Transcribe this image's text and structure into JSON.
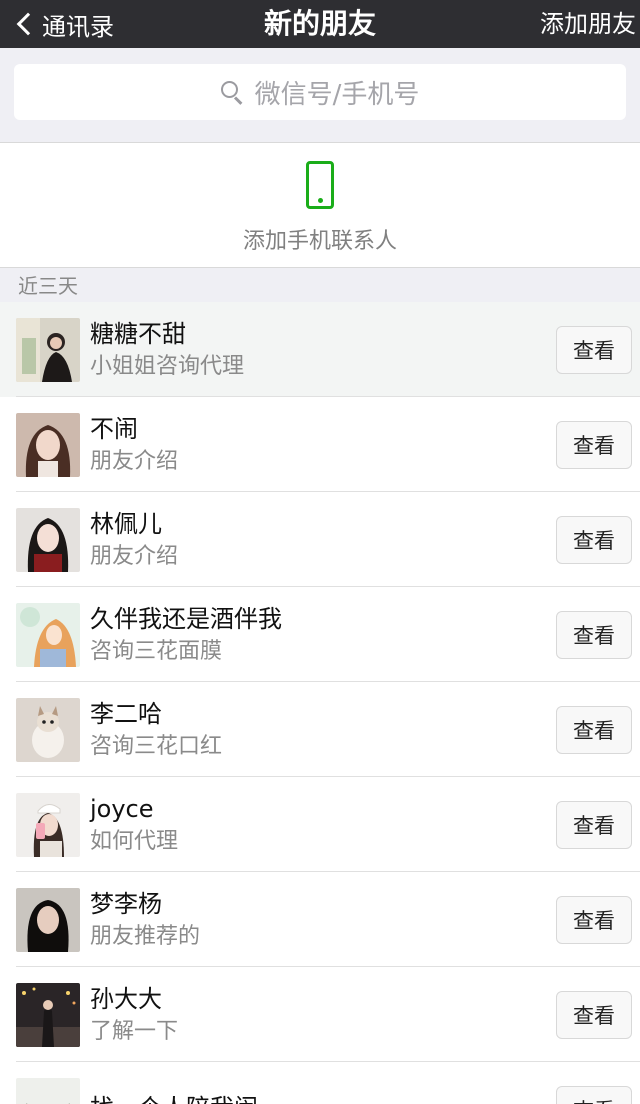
{
  "nav": {
    "back_label": "通讯录",
    "title": "新的朋友",
    "right_label": "添加朋友"
  },
  "search": {
    "placeholder": "微信号/手机号"
  },
  "add_phone": {
    "label": "添加手机联系人"
  },
  "colors": {
    "nav_bg": "#2e2e32",
    "accent": "#1aad19",
    "page_bg": "#efeff4"
  },
  "section": {
    "title": "近三天"
  },
  "contacts": [
    {
      "name": "糖糖不甜",
      "desc": "小姐姐咨询代理",
      "action": "查看"
    },
    {
      "name": "不闹",
      "desc": "朋友介绍",
      "action": "查看"
    },
    {
      "name": "林佩儿",
      "desc": "朋友介绍",
      "action": "查看"
    },
    {
      "name": "久伴我还是酒伴我",
      "desc": "咨询三花面膜",
      "action": "查看"
    },
    {
      "name": "李二哈",
      "desc": "咨询三花口红",
      "action": "查看"
    },
    {
      "name": "joyce",
      "desc": "如何代理",
      "action": "查看"
    },
    {
      "name": "梦李杨",
      "desc": "朋友推荐的",
      "action": "查看"
    },
    {
      "name": "孙大大",
      "desc": "了解一下",
      "action": "查看"
    },
    {
      "name": "找一个人陪我闹",
      "desc": "",
      "action": "查看"
    }
  ]
}
